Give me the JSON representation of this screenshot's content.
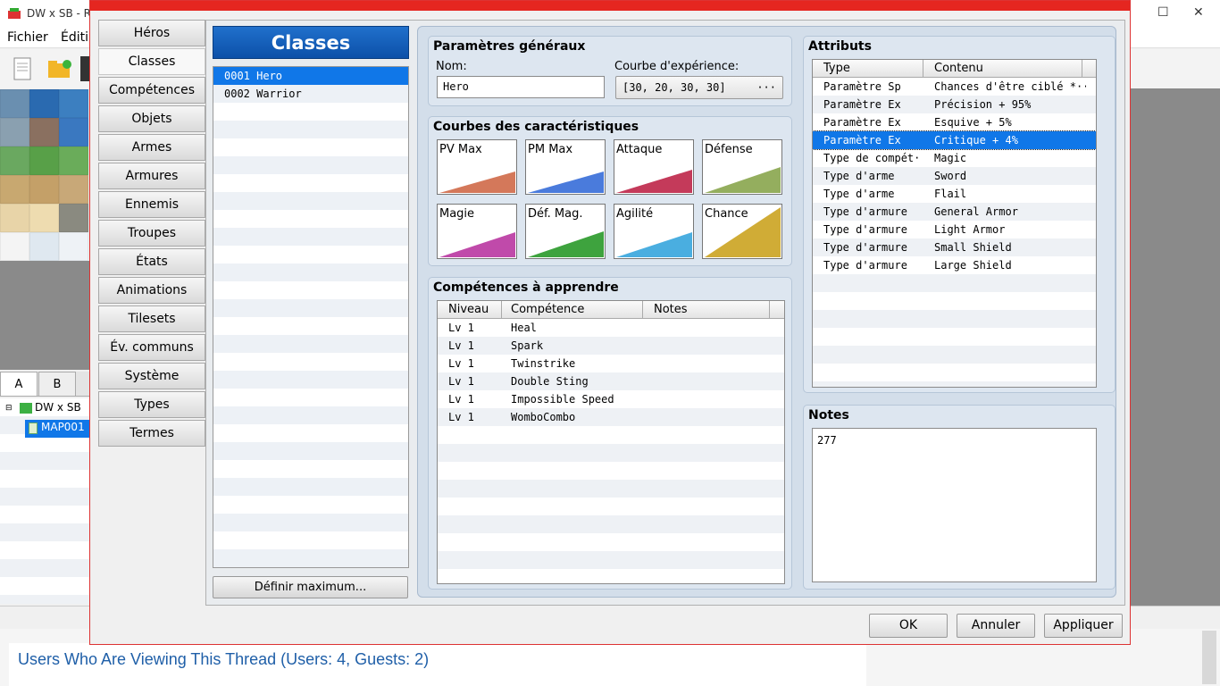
{
  "background": {
    "title": "DW x SB - RPG",
    "menu": [
      "Fichier",
      "Éditi"
    ],
    "tabs": [
      "A",
      "B"
    ],
    "tree": {
      "root": "DW x SB",
      "map": "MAP001"
    },
    "browser_text": "Users Who Are Viewing This Thread (Users: 4, Guests: 2)"
  },
  "dialog": {
    "nav": [
      "Héros",
      "Classes",
      "Compétences",
      "Objets",
      "Armes",
      "Armures",
      "Ennemis",
      "Troupes",
      "États",
      "Animations",
      "Tilesets",
      "Év. communs",
      "Système",
      "Types",
      "Termes"
    ],
    "active_nav": "Classes",
    "classes_title": "Classes",
    "classes": [
      "0001 Hero",
      "0002 Warrior"
    ],
    "max_button": "Définir maximum...",
    "general": {
      "title": "Paramètres généraux",
      "name_label": "Nom:",
      "name_value": "Hero",
      "exp_label": "Courbe d'expérience:",
      "exp_value": "[30, 20, 30, 30]",
      "exp_button": "···"
    },
    "curves": {
      "title": "Courbes des caractéristiques",
      "items": [
        {
          "label": "PV Max",
          "color": "#d4785a",
          "level": 0.42
        },
        {
          "label": "PM Max",
          "color": "#4a7bdc",
          "level": 0.42
        },
        {
          "label": "Attaque",
          "color": "#c43a5a",
          "level": 0.45
        },
        {
          "label": "Défense",
          "color": "#94ae5e",
          "level": 0.5
        },
        {
          "label": "Magie",
          "color": "#c04aaa",
          "level": 0.48
        },
        {
          "label": "Déf. Mag.",
          "color": "#3ea33e",
          "level": 0.5
        },
        {
          "label": "Agilité",
          "color": "#4aaee0",
          "level": 0.48
        },
        {
          "label": "Chance",
          "color": "#d0ac36",
          "level": 0.95
        }
      ]
    },
    "skills": {
      "title": "Compétences à apprendre",
      "headers": [
        "Niveau",
        "Compétence",
        "Notes"
      ],
      "rows": [
        {
          "level": "Lv   1",
          "skill": "Heal"
        },
        {
          "level": "Lv   1",
          "skill": "Spark"
        },
        {
          "level": "Lv   1",
          "skill": "Twinstrike"
        },
        {
          "level": "Lv   1",
          "skill": "Double Sting"
        },
        {
          "level": "Lv   1",
          "skill": "Impossible Speed"
        },
        {
          "level": "Lv   1",
          "skill": "WomboCombo"
        }
      ]
    },
    "attributes": {
      "title": "Attributs",
      "headers": [
        "Type",
        "Contenu"
      ],
      "rows": [
        {
          "type": "Paramètre Sp",
          "content": "Chances d'être ciblé *···"
        },
        {
          "type": "Paramètre Ex",
          "content": "Précision + 95%"
        },
        {
          "type": "Paramètre Ex",
          "content": "Esquive + 5%"
        },
        {
          "type": "Paramètre Ex",
          "content": "Critique + 4%"
        },
        {
          "type": "Type de compét···",
          "content": "Magic"
        },
        {
          "type": "Type d'arme",
          "content": "Sword"
        },
        {
          "type": "Type d'arme",
          "content": "Flail"
        },
        {
          "type": "Type d'armure",
          "content": "General Armor"
        },
        {
          "type": "Type d'armure",
          "content": "Light Armor"
        },
        {
          "type": "Type d'armure",
          "content": "Small Shield"
        },
        {
          "type": "Type d'armure",
          "content": "Large Shield"
        }
      ],
      "selected_index": 3
    },
    "notes": {
      "title": "Notes",
      "value": "277"
    },
    "buttons": {
      "ok": "OK",
      "cancel": "Annuler",
      "apply": "Appliquer"
    }
  }
}
